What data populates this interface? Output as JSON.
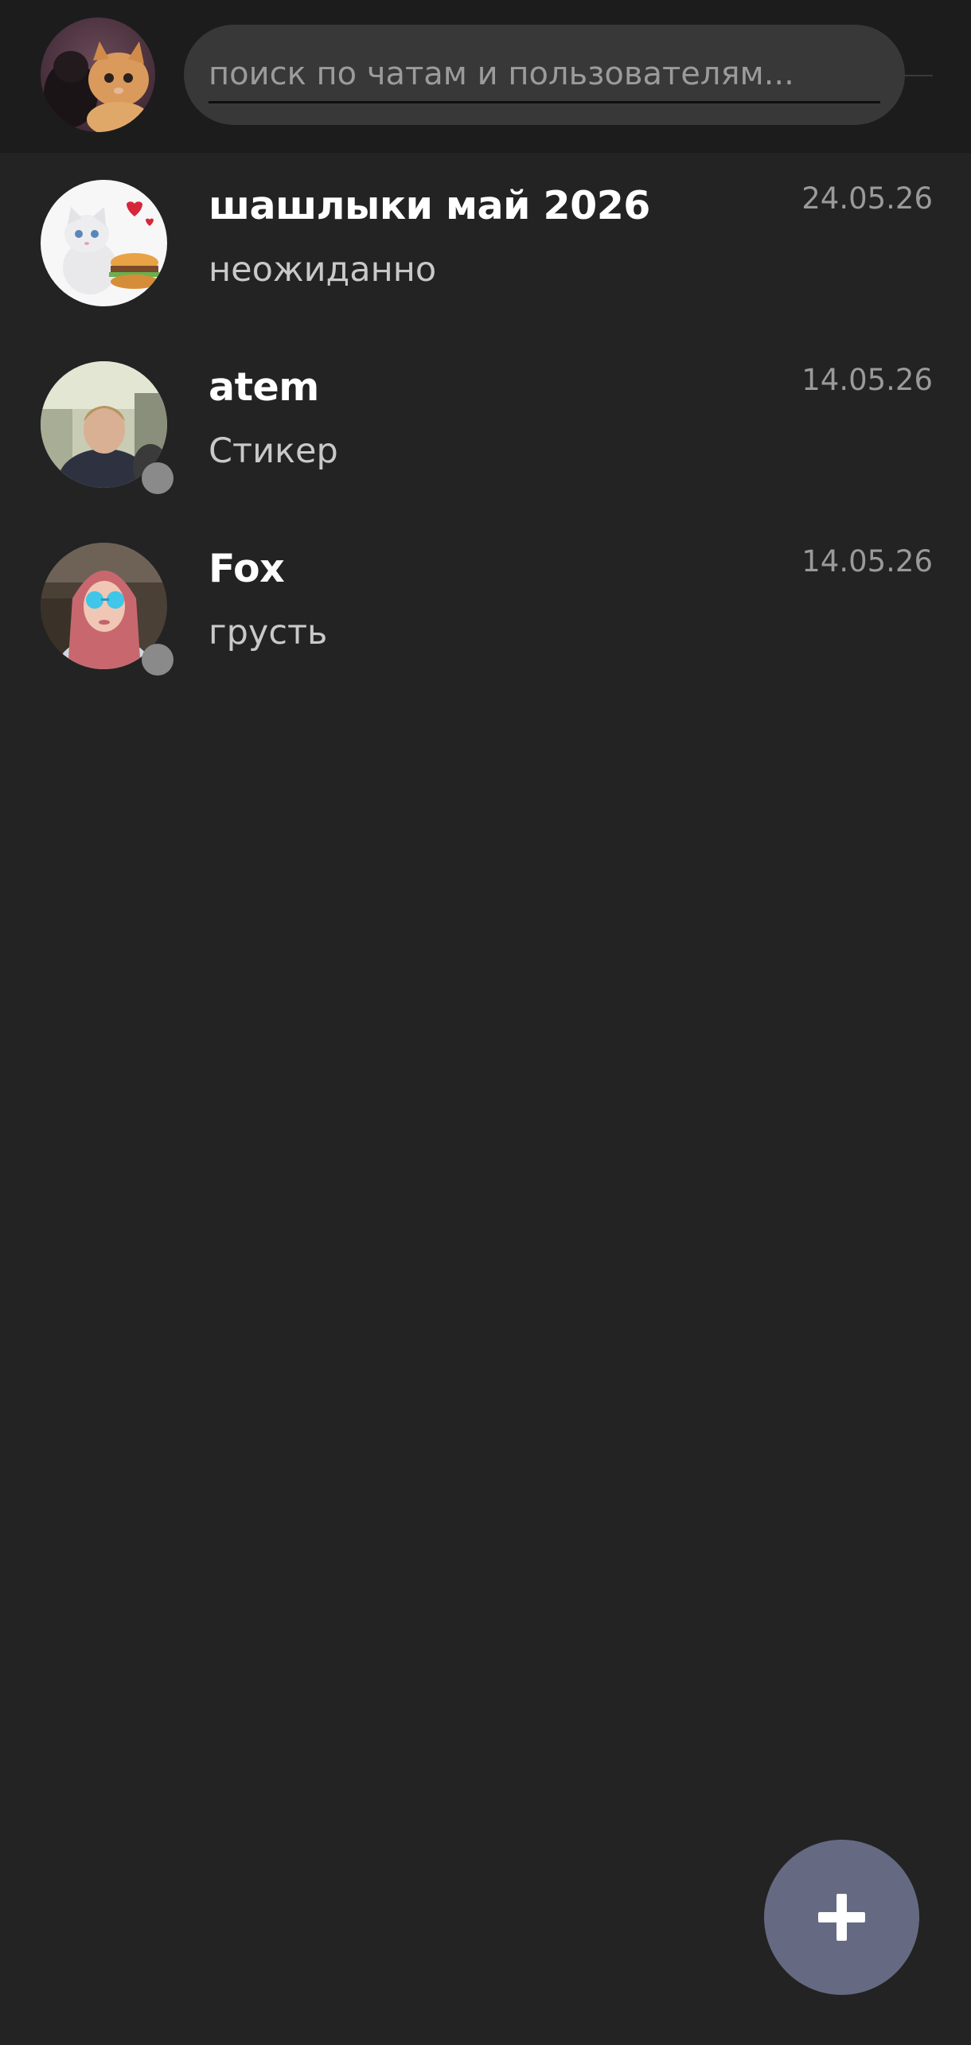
{
  "search": {
    "placeholder": "поиск по чатам и пользователям..."
  },
  "chats": [
    {
      "name": "шашлыки май 2026",
      "preview": "неожиданно",
      "date": "24.05.26",
      "avatar": "kitten-burger-avatar",
      "show_status": false
    },
    {
      "name": "atem",
      "preview": "Стикер",
      "date": "14.05.26",
      "avatar": "person-photo-avatar",
      "show_status": true
    },
    {
      "name": "Fox",
      "preview": "грусть",
      "date": "14.05.26",
      "avatar": "person-photo-avatar",
      "show_status": true
    }
  ],
  "fab": {
    "icon": "plus-icon"
  },
  "colors": {
    "background": "#232323",
    "topbar": "#1c1c1c",
    "search_field": "#383838",
    "fab": "#656a82",
    "status_offline": "#8a8a8a"
  }
}
